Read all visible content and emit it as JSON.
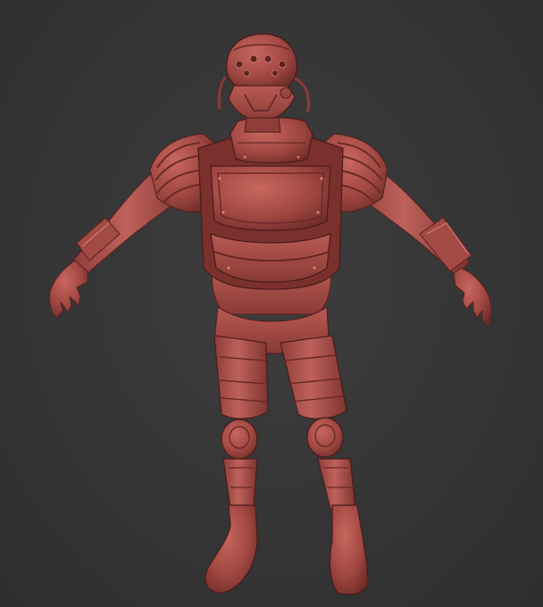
{
  "scene": {
    "subject": "armored-character-sculpt",
    "pose": "a-pose",
    "colors": {
      "background": "#363636",
      "clay_light": "#c0605a",
      "clay_base": "#9e4640",
      "clay_dark": "#6a2a27",
      "clay_deep": "#4a1c1a"
    }
  }
}
